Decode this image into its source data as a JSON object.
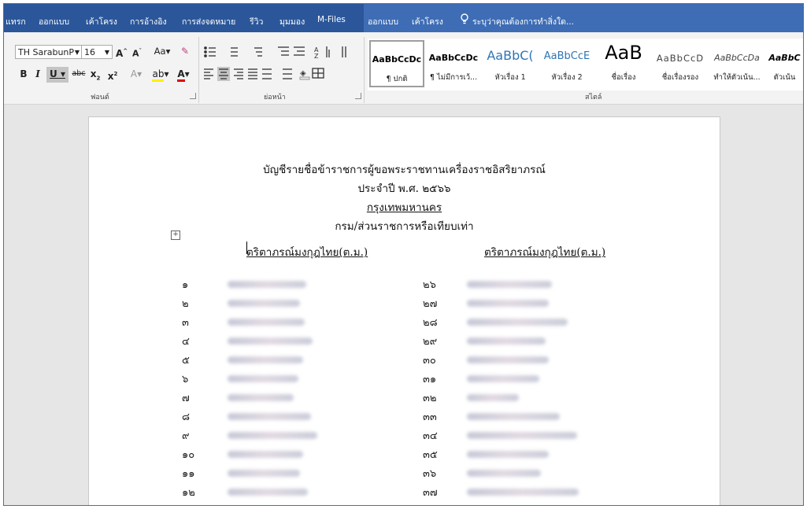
{
  "ribbon_tabs": {
    "left": [
      "แทรก",
      "ออกแบบ",
      "เค้าโครง",
      "การอ้างอิง",
      "การส่งจดหมาย",
      "รีวิว",
      "มุมมอง",
      "M-Files"
    ],
    "contextual": [
      "ออกแบบ",
      "เค้าโครง"
    ],
    "tell_me": "ระบุว่าคุณต้องการทำสิ่งใด..."
  },
  "font_group": {
    "font_name": "TH SarabunP",
    "font_size": "16",
    "label": "ฟอนต์"
  },
  "paragraph_group": {
    "label": "ย่อหน้า"
  },
  "styles_group": {
    "label": "สไตล์",
    "items": [
      {
        "sample": "AaBbCcDc",
        "name": "¶ ปกติ"
      },
      {
        "sample": "AaBbCcDc",
        "name": "¶ ไม่มีการเว้..."
      },
      {
        "sample": "AaBbC(",
        "name": "หัวเรื่อง 1"
      },
      {
        "sample": "AaBbCcE",
        "name": "หัวเรื่อง 2"
      },
      {
        "sample": "AaB",
        "name": "ชื่อเรื่อง"
      },
      {
        "sample": "AaBbCcD",
        "name": "ชื่อเรื่องรอง"
      },
      {
        "sample": "AaBbCcDa",
        "name": "ทำให้ตัวเน้น..."
      },
      {
        "sample": "AaBbC",
        "name": "ตัวเน้น"
      }
    ]
  },
  "document": {
    "title1": "บัญชีรายชื่อข้าราชการผู้ขอพระราชทานเครื่องราชอิสริยาภรณ์",
    "title2": "ประจำปี พ.ศ. ๒๕๖๖",
    "title3": "กรุงเทพมหานคร",
    "title4": "กรม/ส่วนราชการหรือเทียบเท่า",
    "col_left_header": "ตริตาภรณ์มงกุฎไทย(ต.ม.)",
    "col_right_header": "ตริตาภรณ์มงกุฎไทย(ต.ม.)",
    "left_numbers": [
      "๑",
      "๒",
      "๓",
      "๔",
      "๕",
      "๖",
      "๗",
      "๘",
      "๙",
      "๑๐",
      "๑๑",
      "๑๒"
    ],
    "right_numbers": [
      "๒๖",
      "๒๗",
      "๒๘",
      "๒๙",
      "๓๐",
      "๓๑",
      "๓๒",
      "๓๓",
      "๓๔",
      "๓๕",
      "๓๖",
      "๓๗"
    ]
  },
  "colors": {
    "ribbon_blue": "#2b579a",
    "ribbon_bg": "#f3f3f3",
    "page_bg": "#ffffff"
  }
}
